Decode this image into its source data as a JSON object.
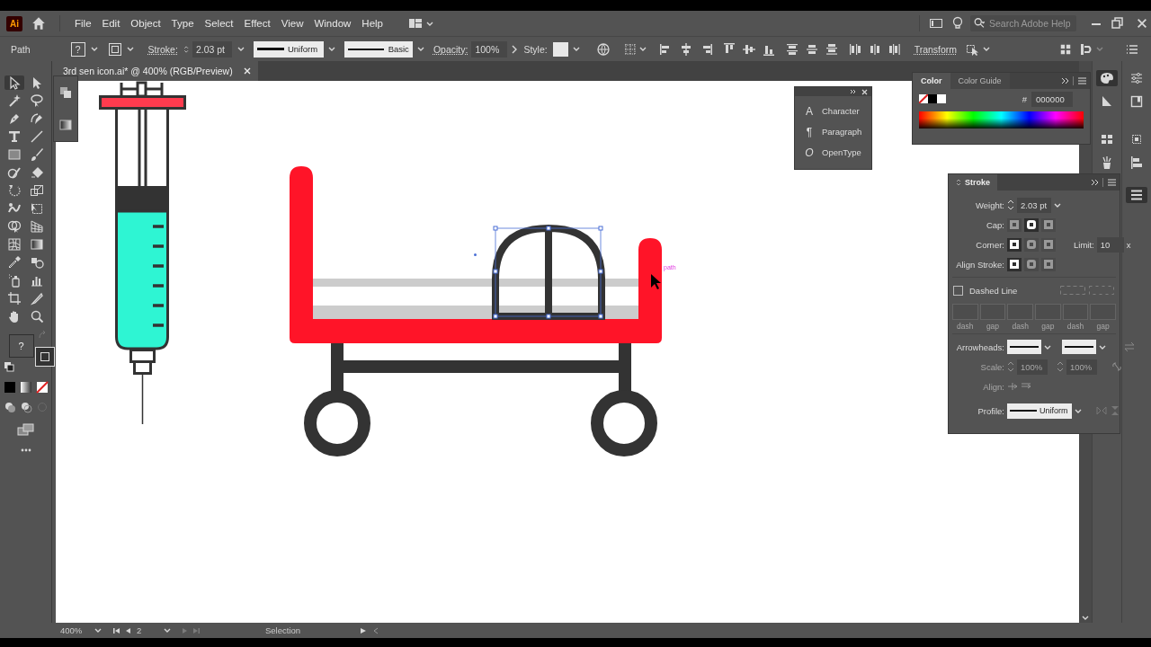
{
  "app": {
    "logo": "Ai"
  },
  "menu": [
    "File",
    "Edit",
    "Object",
    "Type",
    "Select",
    "Effect",
    "View",
    "Window",
    "Help"
  ],
  "search": {
    "placeholder": "Search Adobe Help"
  },
  "control_bar": {
    "selection": "Path",
    "fill_hint": "?",
    "stroke_label": "Stroke:",
    "stroke_weight": "2.03 pt",
    "profile": "Uniform",
    "brush": "Basic",
    "opacity_label": "Opacity:",
    "opacity": "100%",
    "style_label": "Style:",
    "transform": "Transform"
  },
  "document_tab": {
    "title": "3rd sen icon.ai* @ 400% (RGB/Preview)",
    "selected": true
  },
  "toolbar": {
    "fill_hint": "?"
  },
  "canvas": {
    "hover_label": "path"
  },
  "type_panel": {
    "items": [
      {
        "icon": "A",
        "label": "Character"
      },
      {
        "icon": "¶",
        "label": "Paragraph"
      },
      {
        "icon": "O",
        "label": "OpenType"
      }
    ]
  },
  "color_panel": {
    "tabs": [
      {
        "label": "Color",
        "selected": true
      },
      {
        "label": "Color Guide",
        "selected": false
      }
    ],
    "hex_label": "#",
    "hex": "000000"
  },
  "stroke_panel": {
    "title": "Stroke",
    "weight_label": "Weight:",
    "weight": "2.03 pt",
    "cap_label": "Cap:",
    "caps": [
      {
        "selected": false
      },
      {
        "selected": true
      },
      {
        "selected": false
      }
    ],
    "corner_label": "Corner:",
    "corners": [
      {
        "selected": true
      },
      {
        "selected": false
      },
      {
        "selected": false
      }
    ],
    "limit_label": "Limit:",
    "limit": "10",
    "limit_unit": "x",
    "align_label": "Align Stroke:",
    "aligns": [
      {
        "selected": true
      },
      {
        "selected": false
      },
      {
        "selected": false
      }
    ],
    "dashed": {
      "label": "Dashed Line",
      "checked": false
    },
    "dash_fields": {
      "disabled": true,
      "labels": [
        "dash",
        "gap",
        "dash",
        "gap",
        "dash",
        "gap"
      ]
    },
    "arrowheads_label": "Arrowheads:",
    "scale": {
      "label": "Scale:",
      "disabled": true,
      "values": [
        "100%",
        "100%"
      ]
    },
    "arrow_align": {
      "label": "Align:",
      "disabled": true
    },
    "profile_label": "Profile:",
    "profile": "Uniform"
  },
  "status_bar": {
    "zoom": "400%",
    "artboard": "2",
    "tool": "Selection"
  }
}
